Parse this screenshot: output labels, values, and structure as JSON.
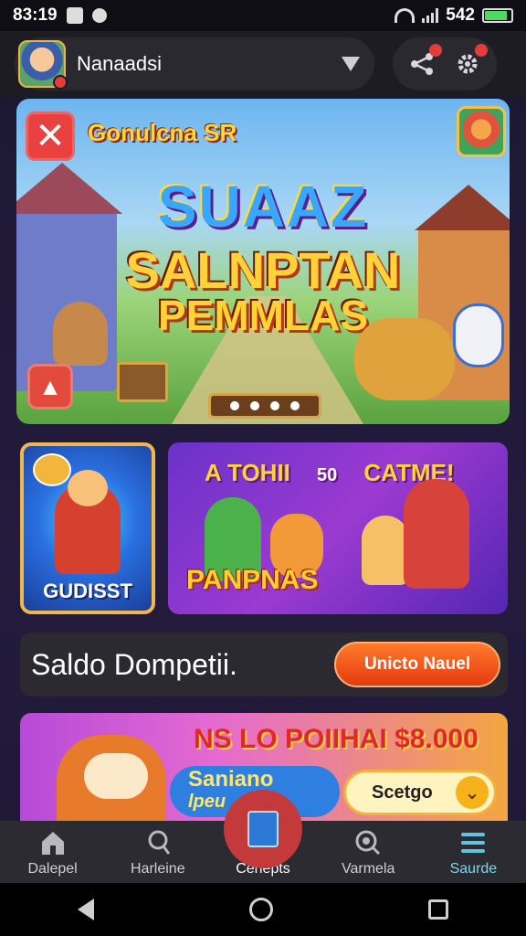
{
  "status_bar": {
    "time": "83:19",
    "battery_text": "542"
  },
  "header": {
    "username": "Nanaadsi"
  },
  "hero": {
    "caption": "Gonulcna SR",
    "title_line1": "SUAAZ",
    "title_line2": "SALNPTAN",
    "title_line3": "PEMMLAS",
    "close_label": "✕"
  },
  "cards": {
    "small_label": "GUDISST",
    "big_title": "A TOHII",
    "big_coin": "50",
    "big_title2": "CATME!",
    "big_bottom": "PANPNAS"
  },
  "competition": {
    "text": "Saldo Dompetii.",
    "button_label": "Unicto Nauel"
  },
  "promo": {
    "headline": "NS LO POIIHAI $8.000",
    "sub_line1": "Saniano",
    "sub_line2": "lpeu",
    "claim_label": "Scetgo"
  },
  "nav": {
    "items": [
      {
        "label": "Dalepel",
        "icon": "home-icon"
      },
      {
        "label": "Harleine",
        "icon": "profile-icon"
      },
      {
        "label": "Cenepts",
        "icon": "document-icon"
      },
      {
        "label": "Varmela",
        "icon": "search-icon"
      },
      {
        "label": "Saurde",
        "icon": "menu-icon"
      }
    ]
  }
}
